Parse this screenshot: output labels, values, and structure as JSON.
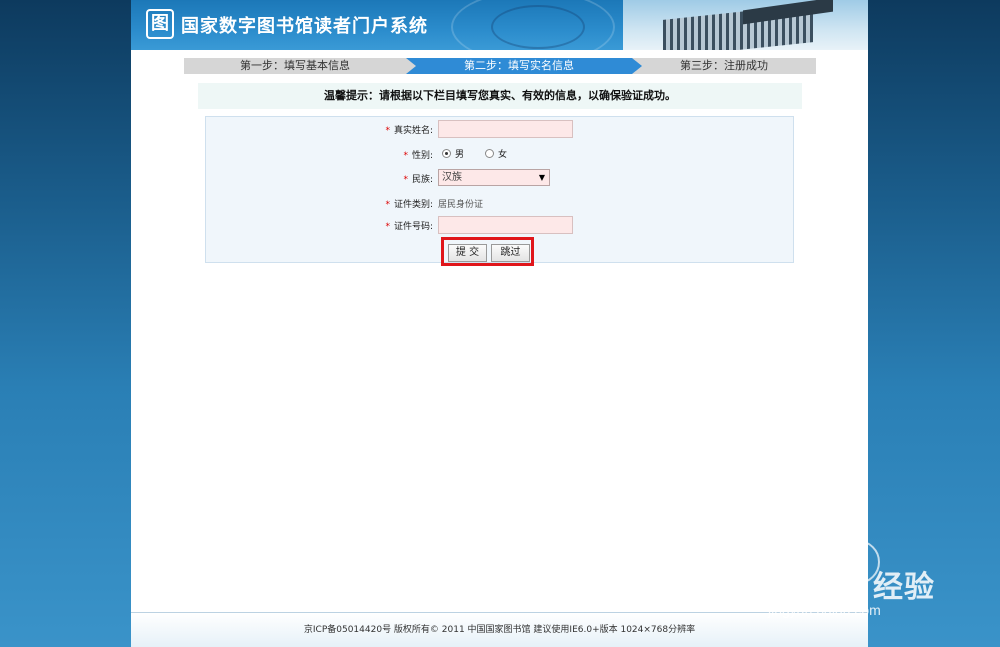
{
  "header": {
    "logo_char": "图",
    "title": "国家数字图书馆读者门户系统"
  },
  "steps": [
    {
      "label": "第一步：填写基本信息",
      "active": false
    },
    {
      "label": "第二步：填写实名信息",
      "active": true
    },
    {
      "label": "第三步：注册成功",
      "active": false
    }
  ],
  "tip": "温馨提示：请根据以下栏目填写您真实、有效的信息，以确保验证成功。",
  "form": {
    "required_mark": "*",
    "real_name_label": "真实姓名:",
    "real_name_value": "",
    "gender_label": "性别:",
    "gender_options": [
      "男",
      "女"
    ],
    "gender_selected": "男",
    "ethnicity_label": "民族:",
    "ethnicity_value": "汉族",
    "id_type_label": "证件类别:",
    "id_type_value": "居民身份证",
    "id_number_label": "证件号码:",
    "id_number_value": ""
  },
  "buttons": {
    "submit": "提 交",
    "skip": "跳过"
  },
  "footer": "京ICP备05014420号 版权所有© 2011 中国国家图书馆 建议使用IE6.0+版本 1024×768分辨率",
  "watermark": {
    "brand": "Bai du 经验",
    "url": "jingyan.baidu.com"
  },
  "colors": {
    "active_step": "#2f8bd6",
    "highlight_box": "#e0161b",
    "input_bg": "#fde8e8"
  }
}
